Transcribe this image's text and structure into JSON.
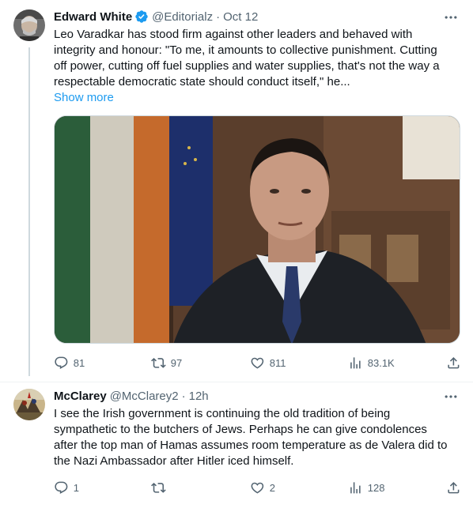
{
  "tweets": [
    {
      "author": "Edward White",
      "handle": "@Editorialz",
      "dot": "·",
      "time": "Oct 12",
      "lines": [
        "Leo Varadkar has stood firm against other leaders and behaved with",
        "integrity and honour: \"To me, it amounts to collective punishment. Cutting",
        "off power, cutting off fuel supplies and water supplies, that's not the way a",
        "respectable democratic state should conduct itself,\" he..."
      ],
      "show_more": "Show more",
      "verified": true,
      "media_alt": "Leo Varadkar seated in an interview setting, Irish and EU flags behind",
      "stats": {
        "replies": "81",
        "reposts": "97",
        "likes": "811",
        "views": "83.1K"
      }
    },
    {
      "author": "McClarey",
      "handle": "@McClarey2",
      "dot": "·",
      "time": "12h",
      "lines": [
        "I see the Irish government is continuing the old tradition of being",
        "sympathetic to the butchers of Jews.  Perhaps he can give condolences",
        "after the top man of Hamas assumes room temperature as de Valera did to",
        "the Nazi Ambassador after Hitler iced himself."
      ],
      "verified": false,
      "stats": {
        "replies": "1",
        "reposts": "",
        "likes": "2",
        "views": "128"
      }
    }
  ],
  "icons": {
    "reply": "reply-icon",
    "repost": "repost-icon",
    "like": "heart-icon",
    "views": "views-chart-icon",
    "share": "share-icon",
    "more": "more-dots-icon",
    "verified": "verified-badge-icon"
  },
  "colors": {
    "accent": "#1d9bf0",
    "text": "#0f1419",
    "muted": "#536471",
    "border": "#cfd9de"
  }
}
